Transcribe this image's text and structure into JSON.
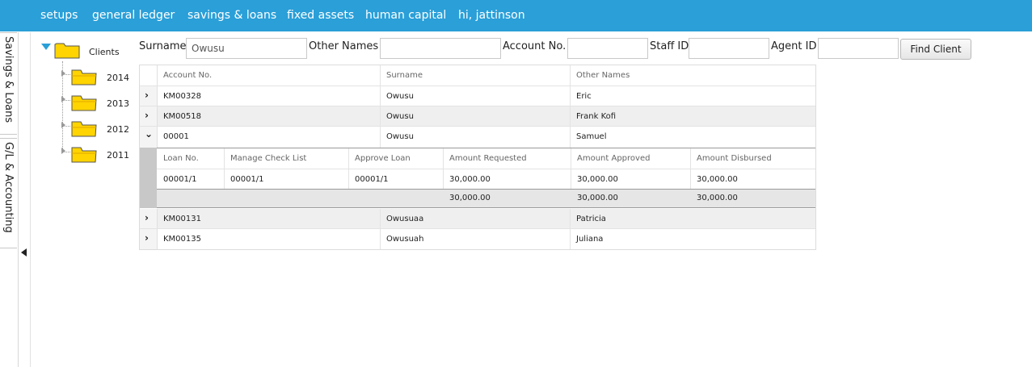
{
  "menu": {
    "items": [
      "setups",
      "general ledger",
      "savings & loans",
      "fixed assets",
      "human capital",
      "hi, jattinson"
    ]
  },
  "vertical_tabs": [
    "Savings & Loans",
    "G/L & Accounting"
  ],
  "tree": {
    "root_label": "Clients",
    "children": [
      "2014",
      "2013",
      "2012",
      "2011"
    ]
  },
  "search": {
    "surname_label": "Surname",
    "surname_value": "Owusu",
    "other_names_label": "Other Names",
    "other_names_value": "",
    "account_no_label": "Account No.",
    "account_no_value": "",
    "staff_id_label": "Staff ID",
    "staff_id_value": "",
    "agent_id_label": "Agent ID",
    "agent_id_value": "",
    "find_button": "Find Client"
  },
  "clients_grid": {
    "columns": [
      "Account No.",
      "Surname",
      "Other Names"
    ],
    "rows": [
      {
        "account": "KM00328",
        "surname": "Owusu",
        "other": "Eric",
        "expanded": false
      },
      {
        "account": "KM00518",
        "surname": "Owusu",
        "other": "Frank Kofi",
        "expanded": false
      },
      {
        "account": "00001",
        "surname": "Owusu",
        "other": "Samuel",
        "expanded": true
      },
      {
        "account": "KM00131",
        "surname": "Owusuaa",
        "other": "Patricia",
        "expanded": false
      },
      {
        "account": "KM00135",
        "surname": "Owusuah",
        "other": "Juliana",
        "expanded": false
      }
    ],
    "collapsed_glyph": "›",
    "expanded_glyph": "⌄"
  },
  "loans_grid": {
    "columns": [
      "Loan No.",
      "Manage Check List",
      "Approve Loan",
      "Amount Requested",
      "Amount Approved",
      "Amount Disbursed"
    ],
    "rows": [
      {
        "loan_no": "00001/1",
        "check_list": "00001/1",
        "approve": "00001/1",
        "requested": "30,000.00",
        "approved": "30,000.00",
        "disbursed": "30,000.00"
      }
    ],
    "totals": {
      "requested": "30,000.00",
      "approved": "30,000.00",
      "disbursed": "30,000.00"
    }
  },
  "colors": {
    "menu_bar": "#2a9fd8",
    "folder": "#ffd400",
    "tree_toggle": "#2a9fd8"
  }
}
